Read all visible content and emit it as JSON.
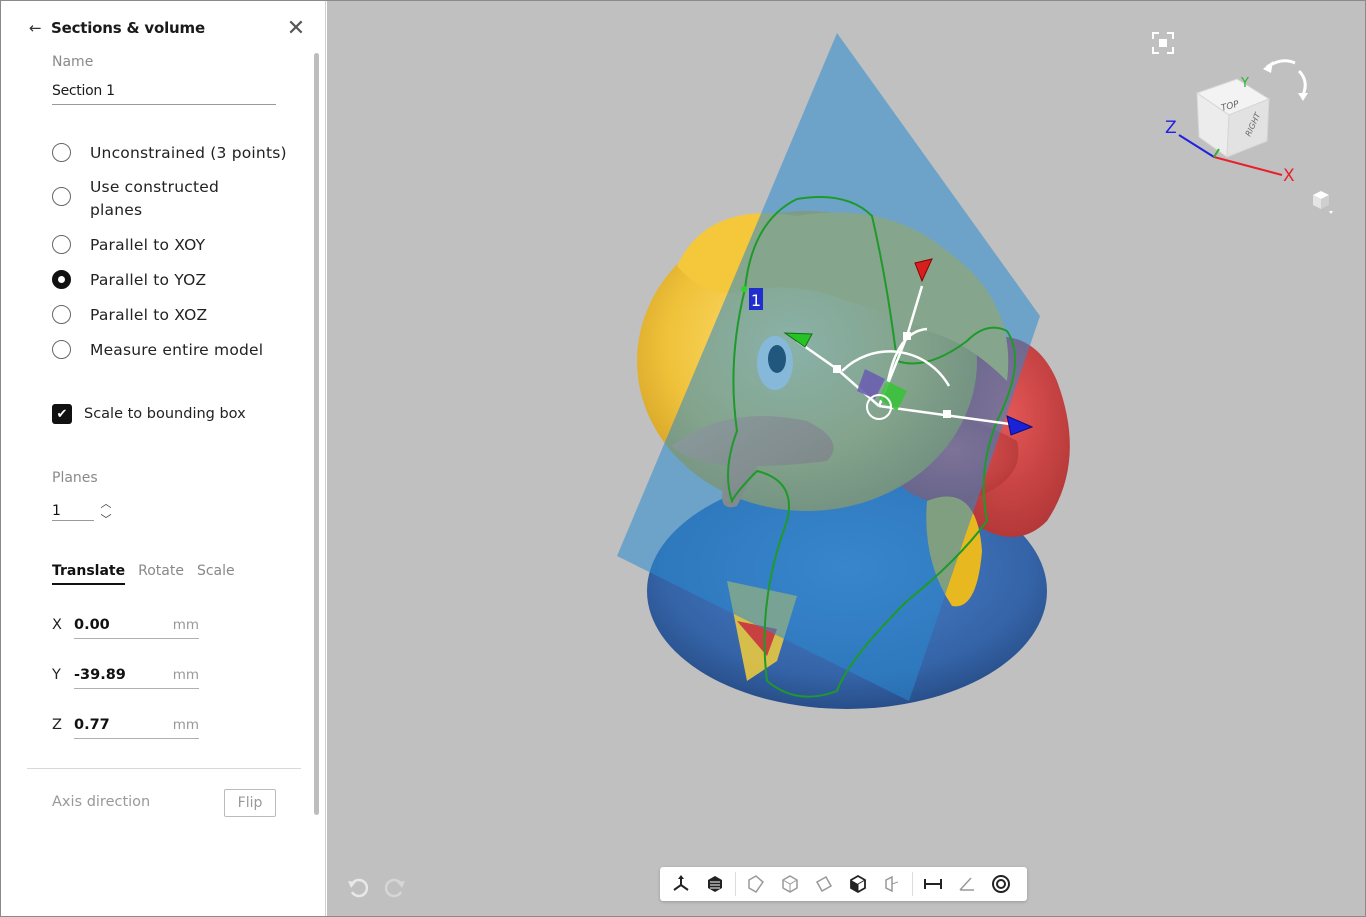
{
  "panel": {
    "back_icon": "arrow-left-icon",
    "title": "Sections & volume",
    "close_icon": "close-icon",
    "name_label": "Name",
    "name_value": "Section 1",
    "options": [
      {
        "label": "Unconstrained (3 points)",
        "checked": false
      },
      {
        "label": "Use constructed planes",
        "checked": false
      },
      {
        "label": "Parallel to XOY",
        "checked": false
      },
      {
        "label": "Parallel to YOZ",
        "checked": true
      },
      {
        "label": "Parallel to XOZ",
        "checked": false
      },
      {
        "label": "Measure entire model",
        "checked": false
      }
    ],
    "scale_checkbox_label": "Scale to bounding box",
    "scale_checked": true,
    "planes_label": "Planes",
    "planes_value": "1",
    "tabs": [
      "Translate",
      "Rotate",
      "Scale"
    ],
    "active_tab": "Translate",
    "coords": [
      {
        "axis": "X",
        "value": "0.00",
        "unit": "mm"
      },
      {
        "axis": "Y",
        "value": "-39.89",
        "unit": "mm"
      },
      {
        "axis": "Z",
        "value": "0.77",
        "unit": "mm"
      }
    ],
    "axis_direction_label": "Axis direction",
    "flip_label": "Flip"
  },
  "viewport": {
    "background": "#c0c0c0",
    "section_marker_label": "1",
    "navcube": {
      "top_label": "TOP",
      "right_label": "RIGHT",
      "axis_labels": {
        "x": "X",
        "y": "Y",
        "z": "Z"
      },
      "axis_colors": {
        "x": "#e8202a",
        "y": "#2bb52b",
        "z": "#2020e0"
      }
    },
    "toolbar_icons": [
      "gizmo-icon",
      "solid-view-icon",
      "wireframe-view-icon",
      "xray-view-icon",
      "transparent-view-icon",
      "cube-view-icon",
      "section-view-icon",
      "distance-measure-icon",
      "angle-measure-icon",
      "target-icon"
    ],
    "undo_icon": "undo-icon",
    "redo_icon": "redo-icon",
    "fit_icon": "fit-to-view-icon",
    "perspective_icon": "perspective-cube-icon"
  }
}
